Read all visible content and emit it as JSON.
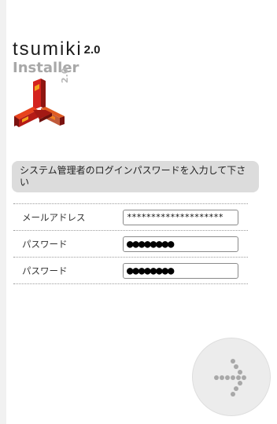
{
  "brand": {
    "name": "tsumiki",
    "version": "2.0",
    "subtitle": "Installer",
    "logo_version": "2.0"
  },
  "banner": {
    "text": "システム管理者のログインパスワードを入力して下さい"
  },
  "form": {
    "rows": [
      {
        "label": "メールアドレス",
        "value": "********************"
      },
      {
        "label": "パスワード",
        "value": "●●●●●●●●"
      },
      {
        "label": "パスワード",
        "value": "●●●●●●●●"
      }
    ]
  },
  "colors": {
    "logo_red": "#c8201c",
    "logo_orange": "#ea6a1c",
    "banner_bg": "#dcdcdc",
    "button_bg": "#ececec",
    "arrow_dots": "#a8a8a8"
  },
  "icons": {
    "next": "chevron-right-dotted-icon"
  }
}
